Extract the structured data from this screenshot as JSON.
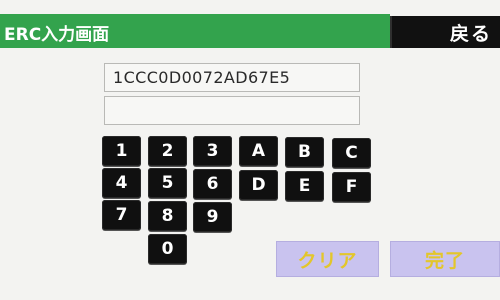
{
  "header": {
    "title": "ERC入力画面",
    "back_label": "戻る"
  },
  "fields": {
    "code_value": "1CCC0D0072AD67E5",
    "second_value": ""
  },
  "keypad": {
    "keys": [
      "1",
      "2",
      "3",
      "A",
      "B",
      "C",
      "4",
      "5",
      "6",
      "D",
      "E",
      "F",
      "7",
      "8",
      "9",
      "0"
    ]
  },
  "actions": {
    "clear_label": "クリア",
    "done_label": "完了"
  },
  "colors": {
    "title_bar": "#33a34d",
    "key_bg": "#101010",
    "action_bg": "#c9c3ef",
    "action_text": "#e3c62b"
  }
}
